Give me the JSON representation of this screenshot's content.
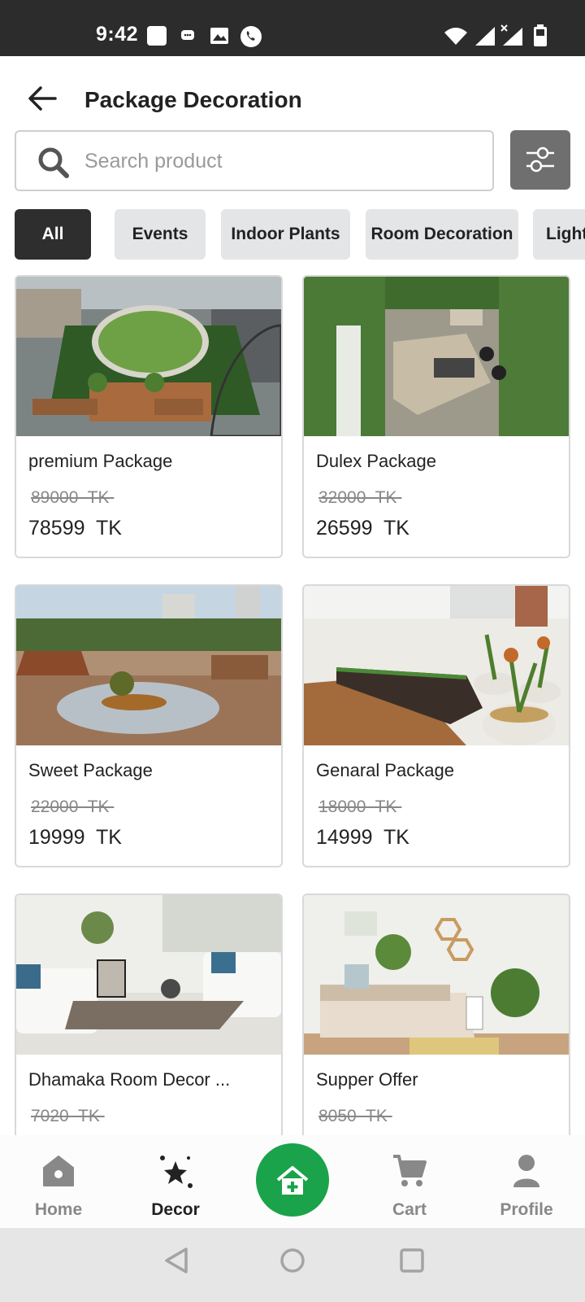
{
  "status_bar": {
    "time": "9:42"
  },
  "header": {
    "title": "Package Decoration"
  },
  "search": {
    "placeholder": "Search product",
    "value": ""
  },
  "categories": [
    "All",
    "Events",
    "Indoor Plants",
    "Room Decoration",
    "Light"
  ],
  "products": [
    {
      "name": "premium Package",
      "old_price": "89000  TK ",
      "price": "78599  TK"
    },
    {
      "name": "Dulex Package",
      "old_price": "32000  TK ",
      "price": "26599  TK"
    },
    {
      "name": "Sweet Package",
      "old_price": "22000  TK ",
      "price": "19999  TK"
    },
    {
      "name": "Genaral Package",
      "old_price": "18000  TK ",
      "price": "14999  TK"
    },
    {
      "name": "Dhamaka Room Decor ...",
      "old_price": "7020  TK ",
      "price": ""
    },
    {
      "name": "Supper Offer",
      "old_price": "8050  TK ",
      "price": ""
    }
  ],
  "bottom_nav": {
    "home": "Home",
    "decor": "Decor",
    "cart": "Cart",
    "profile": "Profile"
  },
  "colors": {
    "accent": "#1aa34a",
    "chip_active": "#2e2e2e",
    "chip_inactive": "#e3e5e7",
    "status_bar": "#2c2c2c"
  }
}
